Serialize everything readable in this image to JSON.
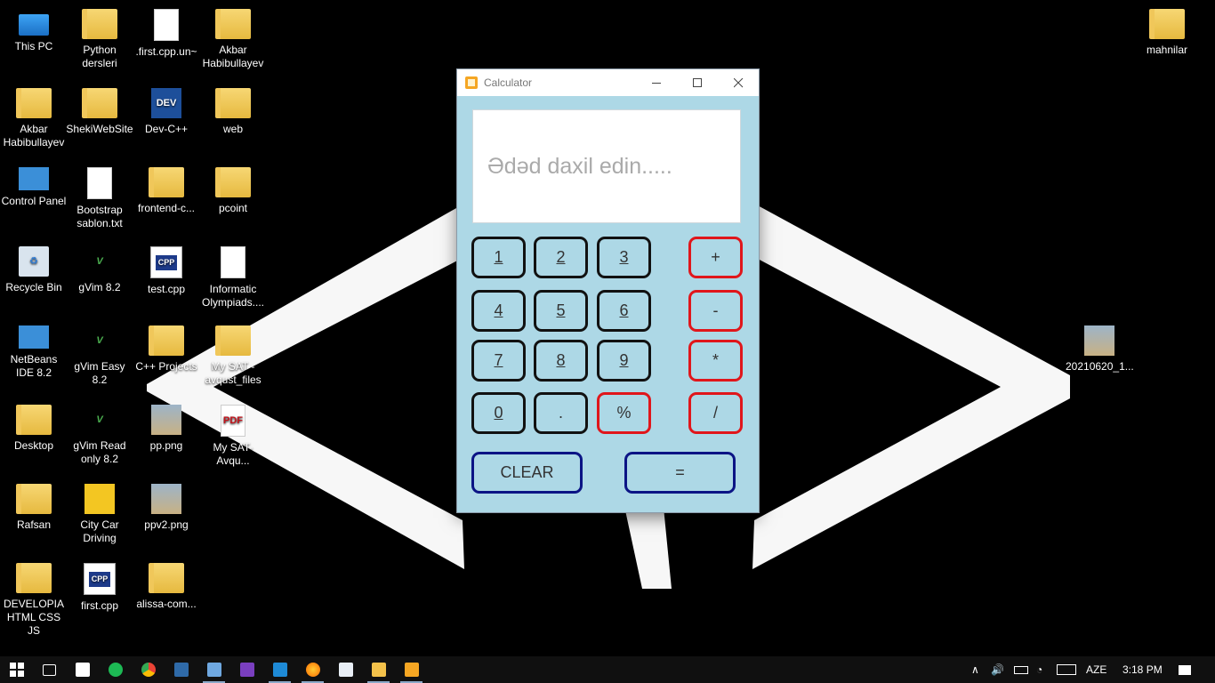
{
  "desktop": {
    "icons": [
      {
        "label": "This PC",
        "icon": "computer-icon"
      },
      {
        "label": "Python dersleri",
        "icon": "folder-icon"
      },
      {
        "label": ".first.cpp.un~",
        "icon": "file-icon"
      },
      {
        "label": "Akbar Habibullayev",
        "icon": "folder-icon"
      },
      {
        "label": "Akbar Habibullayev",
        "icon": "user-folder-icon"
      },
      {
        "label": "ShekiWebSite",
        "icon": "folder-icon"
      },
      {
        "label": "Dev-C++",
        "icon": "devcpp-icon"
      },
      {
        "label": "web",
        "icon": "folder-icon"
      },
      {
        "label": "Control Panel",
        "icon": "control-panel-icon"
      },
      {
        "label": "Bootstrap sablon.txt",
        "icon": "text-file-icon"
      },
      {
        "label": "frontend-c...",
        "icon": "folder-icon"
      },
      {
        "label": "pcoint",
        "icon": "folder-icon"
      },
      {
        "label": "Recycle Bin",
        "icon": "recycle-bin-icon"
      },
      {
        "label": "gVim 8.2",
        "icon": "vim-icon"
      },
      {
        "label": "test.cpp",
        "icon": "cpp-file-icon"
      },
      {
        "label": "Informatic Olympiads....",
        "icon": "file-icon"
      },
      {
        "label": "NetBeans IDE 8.2",
        "icon": "netbeans-icon"
      },
      {
        "label": "gVim Easy 8.2",
        "icon": "vim-icon"
      },
      {
        "label": "C++ Projects",
        "icon": "folder-icon"
      },
      {
        "label": "My SAT - avqust_files",
        "icon": "folder-icon"
      },
      {
        "label": "Desktop",
        "icon": "folder-icon"
      },
      {
        "label": "gVim Read only 8.2",
        "icon": "vim-icon"
      },
      {
        "label": "pp.png",
        "icon": "image-icon"
      },
      {
        "label": "My SAT-Avqu...",
        "icon": "pdf-icon"
      },
      {
        "label": "Rafsan",
        "icon": "folder-icon"
      },
      {
        "label": "City Car Driving",
        "icon": "game-icon"
      },
      {
        "label": "ppv2.png",
        "icon": "image-icon"
      },
      {
        "label": "DEVELOPIA HTML CSS JS",
        "icon": "folder-icon"
      },
      {
        "label": "first.cpp",
        "icon": "cpp-file-icon"
      },
      {
        "label": "alissa-com...",
        "icon": "folder-icon"
      },
      {
        "label": "mahnilar",
        "icon": "folder-icon"
      },
      {
        "label": "20210620_1...",
        "icon": "image-icon"
      }
    ]
  },
  "calculator": {
    "title": "Calculator",
    "display_placeholder": "Ədəd daxil edin.....",
    "keys": {
      "k1": "1",
      "k2": "2",
      "k3": "3",
      "plus": "+",
      "k4": "4",
      "k5": "5",
      "k6": "6",
      "minus": "-",
      "k7": "7",
      "k8": "8",
      "k9": "9",
      "multiply": "*",
      "k0": "0",
      "dot": ".",
      "percent": "%",
      "divide": "/"
    },
    "clear_label": "CLEAR",
    "equals_label": "=",
    "colors": {
      "background": "#add8e6",
      "digit_border": "#111111",
      "operator_border": "#e0161b",
      "action_border": "#0b1485"
    }
  },
  "taskbar": {
    "apps": [
      "start-icon",
      "task-view-icon",
      "store-icon",
      "spotify-icon",
      "chrome-icon",
      "terminal-icon",
      "virtualbox-icon",
      "visual-studio-icon",
      "vscode-icon",
      "firefox-icon",
      "calculator-app-icon",
      "file-explorer-icon",
      "calculator-icon"
    ],
    "language": "AZE",
    "time": "3:18 PM"
  }
}
